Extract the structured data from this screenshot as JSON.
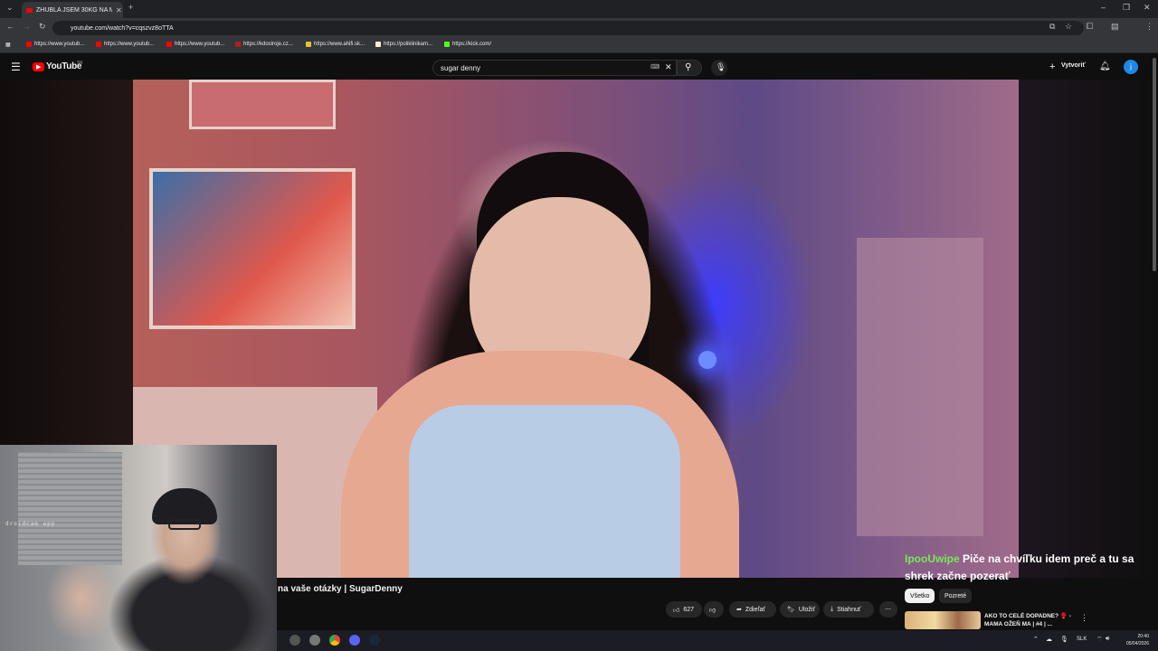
{
  "browser": {
    "tab_title": "ZHUBLA JSEM 30KG NA MOUNJARU!?",
    "url": "youtube.com/watch?v=cqszvz8oTTA",
    "bookmarks": [
      "https://www.youtub...",
      "https://www.youtub...",
      "https://www.youtub...",
      "https://kdoslroje.cz...",
      "https://www.ahifi.sk...",
      "https://poliklinikam...",
      "https://kick.com/"
    ]
  },
  "youtube": {
    "logo": "YouTube",
    "region": "SK",
    "search_value": "sugar denny",
    "create_label": "Vytvoriť",
    "avatar_letter": "j"
  },
  "video": {
    "title_visible": "na vaše otázky | SugarDenny",
    "likes": "627",
    "share": "Zdieľať",
    "save": "Uložiť",
    "download": "Stiahnuť"
  },
  "chat": {
    "user": "IpooUwipe",
    "message": "Piče na chvíľku idem preč a tu sa shrek začne pozerať"
  },
  "chips": {
    "all": "Všetko",
    "watched": "Pozreté"
  },
  "recommendation": {
    "title": "AKO TO CELÉ DOPADNE? 🥊 - MAMA OŽEŇ MA | #4 | ..."
  },
  "webcam": {
    "watermark": "droidcam app"
  },
  "taskbar": {
    "lang": "SLK",
    "time": "20:40",
    "date": "05/04/2026"
  },
  "colors": {
    "accent_red": "#ff0000",
    "chat_user": "#79e85b"
  }
}
